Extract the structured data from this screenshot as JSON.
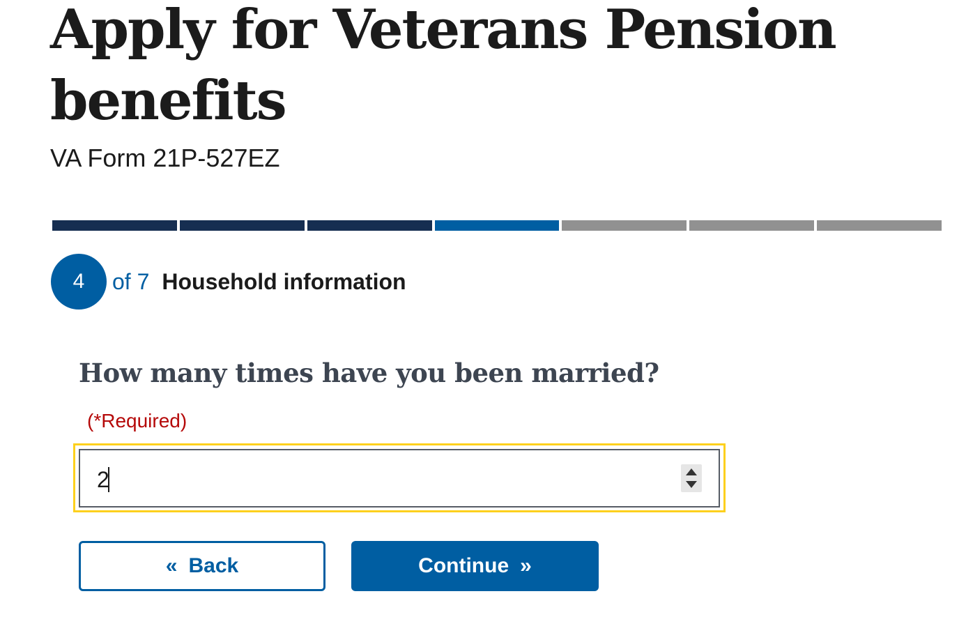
{
  "header": {
    "title": "Apply for Veterans Pension benefits",
    "form_number": "VA Form 21P-527EZ"
  },
  "progress": {
    "current_step": 4,
    "total_steps": 7,
    "segments": [
      "complete",
      "complete",
      "complete",
      "current",
      "incomplete",
      "incomplete",
      "incomplete"
    ]
  },
  "step": {
    "number": "4",
    "of_label": "of 7",
    "title": "Household information"
  },
  "question": {
    "label": "How many times have you been married?",
    "required_label": "(*Required)",
    "input_value": "2",
    "input_type": "number"
  },
  "buttons": {
    "back_label": "Back",
    "back_icon": "double-chevron-left-icon",
    "continue_label": "Continue",
    "continue_icon": "double-chevron-right-icon"
  },
  "colors": {
    "segment_complete": "#162e51",
    "segment_current": "#005ea2",
    "segment_incomplete": "#919191",
    "primary": "#005ea2",
    "required": "#b50909",
    "focus": "#fdd01d",
    "question_text": "#3d4551"
  }
}
